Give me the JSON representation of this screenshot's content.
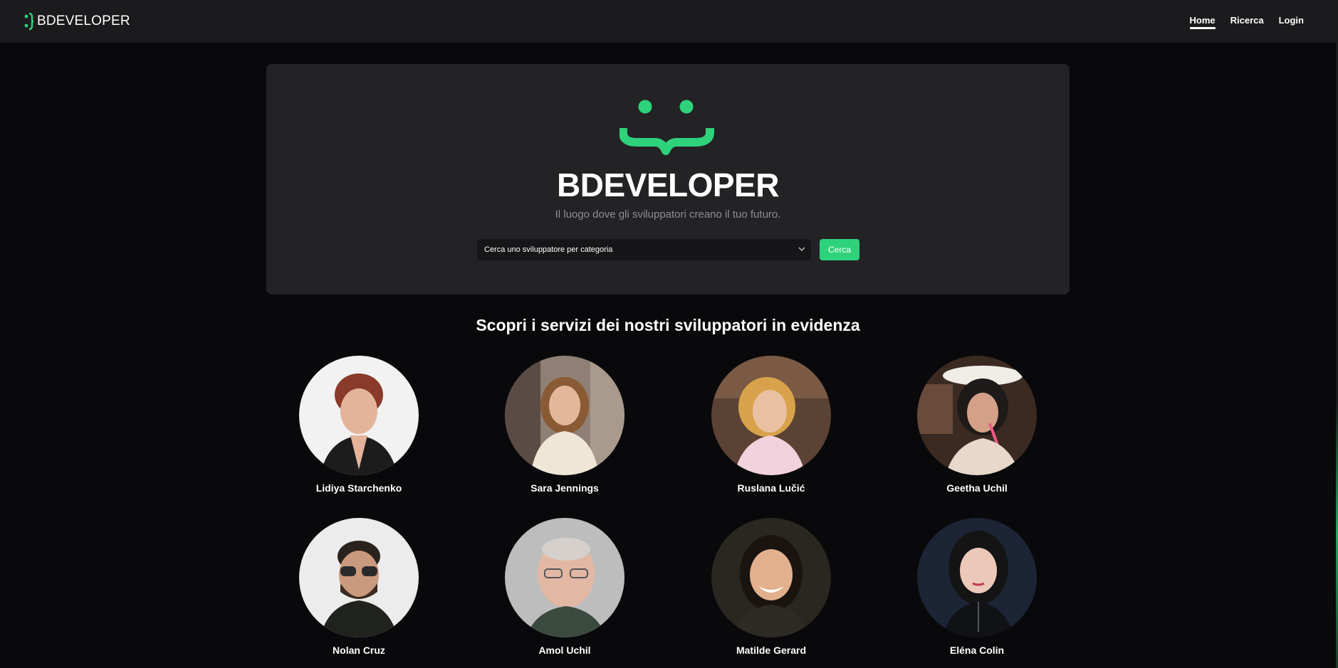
{
  "nav": {
    "brand": "BDEVELOPER",
    "links": [
      {
        "label": "Home",
        "active": true
      },
      {
        "label": "Ricerca",
        "active": false
      },
      {
        "label": "Login",
        "active": false
      }
    ]
  },
  "hero": {
    "title": "BDEVELOPER",
    "subtitle": "Il luogo dove gli sviluppatori creano il tuo futuro.",
    "search_placeholder": "Cerca uno sviluppatore per categoria",
    "search_button": "Cerca"
  },
  "section_title": "Scopri i servizi dei nostri sviluppatori in evidenza",
  "developers": [
    {
      "name": "Lidiya Starchenko"
    },
    {
      "name": "Sara Jennings"
    },
    {
      "name": "Ruslana Lučić"
    },
    {
      "name": "Geetha Uchil"
    },
    {
      "name": "Nolan Cruz"
    },
    {
      "name": "Amol Uchil"
    },
    {
      "name": "Matilde Gerard"
    },
    {
      "name": "Eléna Colin"
    }
  ],
  "colors": {
    "accent": "#2ed27a",
    "background": "#09090b",
    "navbar": "#1b1b1d",
    "hero": "#232325"
  }
}
